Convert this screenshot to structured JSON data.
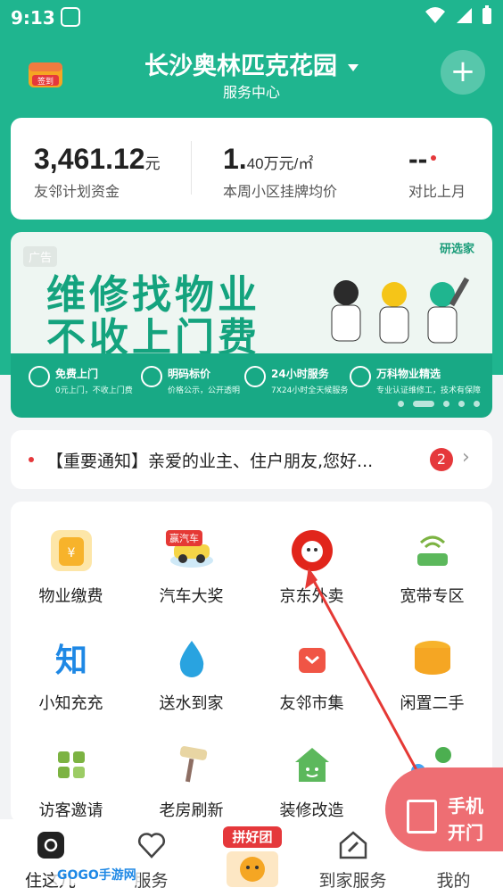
{
  "status_bar": {
    "time": "9:13"
  },
  "header": {
    "checkin_label": "签到",
    "project_name": "长沙奥林匹克花园",
    "subtitle": "服务中心",
    "add_label": "+"
  },
  "stats": [
    {
      "value": "3,461.12",
      "unit": "元",
      "label": "友邻计划资金"
    },
    {
      "value": "1.",
      "value_small": "40",
      "unit": "万元/㎡",
      "label": "本周小区挂牌均价"
    },
    {
      "value": "--",
      "unit": "",
      "label": "对比上月"
    }
  ],
  "ad": {
    "tag": "广告",
    "brand": "研选家",
    "line1": "维修找物业",
    "line2": "不收上门费",
    "features": [
      {
        "title": "免费上门",
        "desc": "0元上门，不收上门费"
      },
      {
        "title": "明码标价",
        "desc": "价格公示，公开透明"
      },
      {
        "title": "24小时服务",
        "desc": "7X24小时全天候服务"
      },
      {
        "title": "万科物业精选",
        "desc": "专业认证维修工，技术有保障"
      }
    ]
  },
  "notice": {
    "text": "【重要通知】亲爱的业主、住户朋友,您好...",
    "count": "2"
  },
  "services": [
    {
      "label": "物业缴费",
      "icon": "fee-icon",
      "color": "#f7b32b"
    },
    {
      "label": "汽车大奖",
      "icon": "car-icon",
      "color": "#f5d547",
      "badge": "赢汽车"
    },
    {
      "label": "京东外卖",
      "icon": "jd-takeout-icon",
      "color": "#e1251b"
    },
    {
      "label": "宽带专区",
      "icon": "broadband-icon",
      "color": "#5cb85c"
    },
    {
      "label": "小知充充",
      "icon": "zhi-icon",
      "color": "#1e88e5"
    },
    {
      "label": "送水到家",
      "icon": "water-drop-icon",
      "color": "#29a3e0"
    },
    {
      "label": "友邻市集",
      "icon": "market-bag-icon",
      "color": "#f05545"
    },
    {
      "label": "闲置二手",
      "icon": "coins-icon",
      "color": "#f7b32b"
    },
    {
      "label": "访客邀请",
      "icon": "qr-code-icon",
      "color": "#7cb342"
    },
    {
      "label": "老房刷新",
      "icon": "paint-roller-icon",
      "color": "#c8a46e"
    },
    {
      "label": "装修改造",
      "icon": "house-smile-icon",
      "color": "#5cb85c"
    },
    {
      "label": "",
      "icon": "more-bubbles-icon",
      "color": "#4caf50"
    }
  ],
  "door": {
    "label": "手机开门"
  },
  "nav": [
    {
      "label": "住这儿",
      "icon": "home-icon",
      "active": true
    },
    {
      "label": "服务",
      "icon": "heart-icon"
    },
    {
      "label": "拼好团",
      "icon": "group-buy-icon"
    },
    {
      "label": "到家服务",
      "icon": "wrench-house-icon"
    },
    {
      "label": "我的",
      "icon": "profile-icon"
    }
  ],
  "watermark": "GOGO手游网",
  "colors": {
    "brand_green": "#1fb58f",
    "alert_red": "#e5383b",
    "door_pink": "#ee6e73"
  }
}
